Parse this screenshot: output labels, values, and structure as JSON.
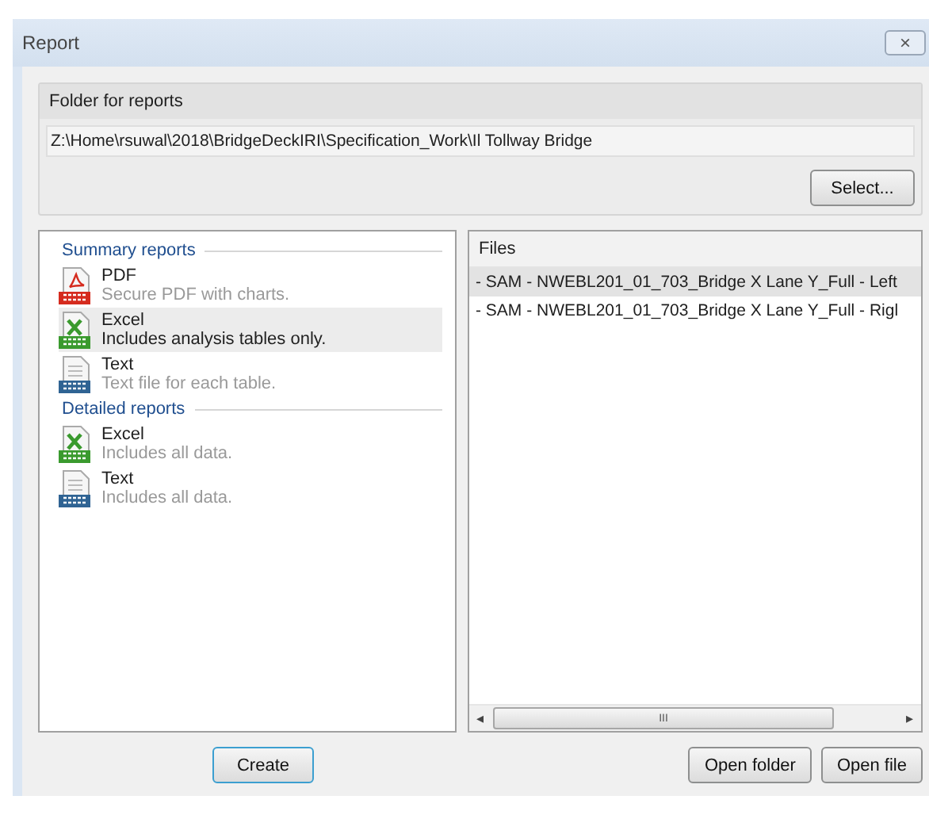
{
  "window": {
    "title": "Report",
    "close": "×"
  },
  "folder": {
    "title": "Folder for reports",
    "path": "Z:\\Home\\rsuwal\\2018\\BridgeDeckIRI\\Specification_Work\\Il Tollway Bridge",
    "button": "Select..."
  },
  "sections": [
    {
      "title": "Summary reports",
      "items": [
        {
          "kind": "pdf",
          "name": "PDF",
          "description": "Secure PDF with charts.",
          "selected": false
        },
        {
          "kind": "xls",
          "name": "Excel",
          "description": "Includes analysis tables only.",
          "selected": true
        },
        {
          "kind": "txt",
          "name": "Text",
          "description": "Text file for each table.",
          "selected": false
        }
      ]
    },
    {
      "title": "Detailed reports",
      "items": [
        {
          "kind": "xls",
          "name": "Excel",
          "description": "Includes all data.",
          "selected": false
        },
        {
          "kind": "txt",
          "name": "Text",
          "description": "Includes all data.",
          "selected": false
        }
      ]
    }
  ],
  "files": {
    "title": "Files",
    "rows": [
      {
        "text": "- SAM - NWEBL201_01_703_Bridge X Lane Y_Full - Left",
        "selected": true
      },
      {
        "text": "- SAM - NWEBL201_01_703_Bridge X Lane Y_Full - Rigl",
        "selected": false
      }
    ],
    "scroll_left": "◂",
    "scroll_grip": "III",
    "scroll_right": "▸"
  },
  "buttons": {
    "create": "Create",
    "open_folder": "Open folder",
    "open_file": "Open file"
  }
}
